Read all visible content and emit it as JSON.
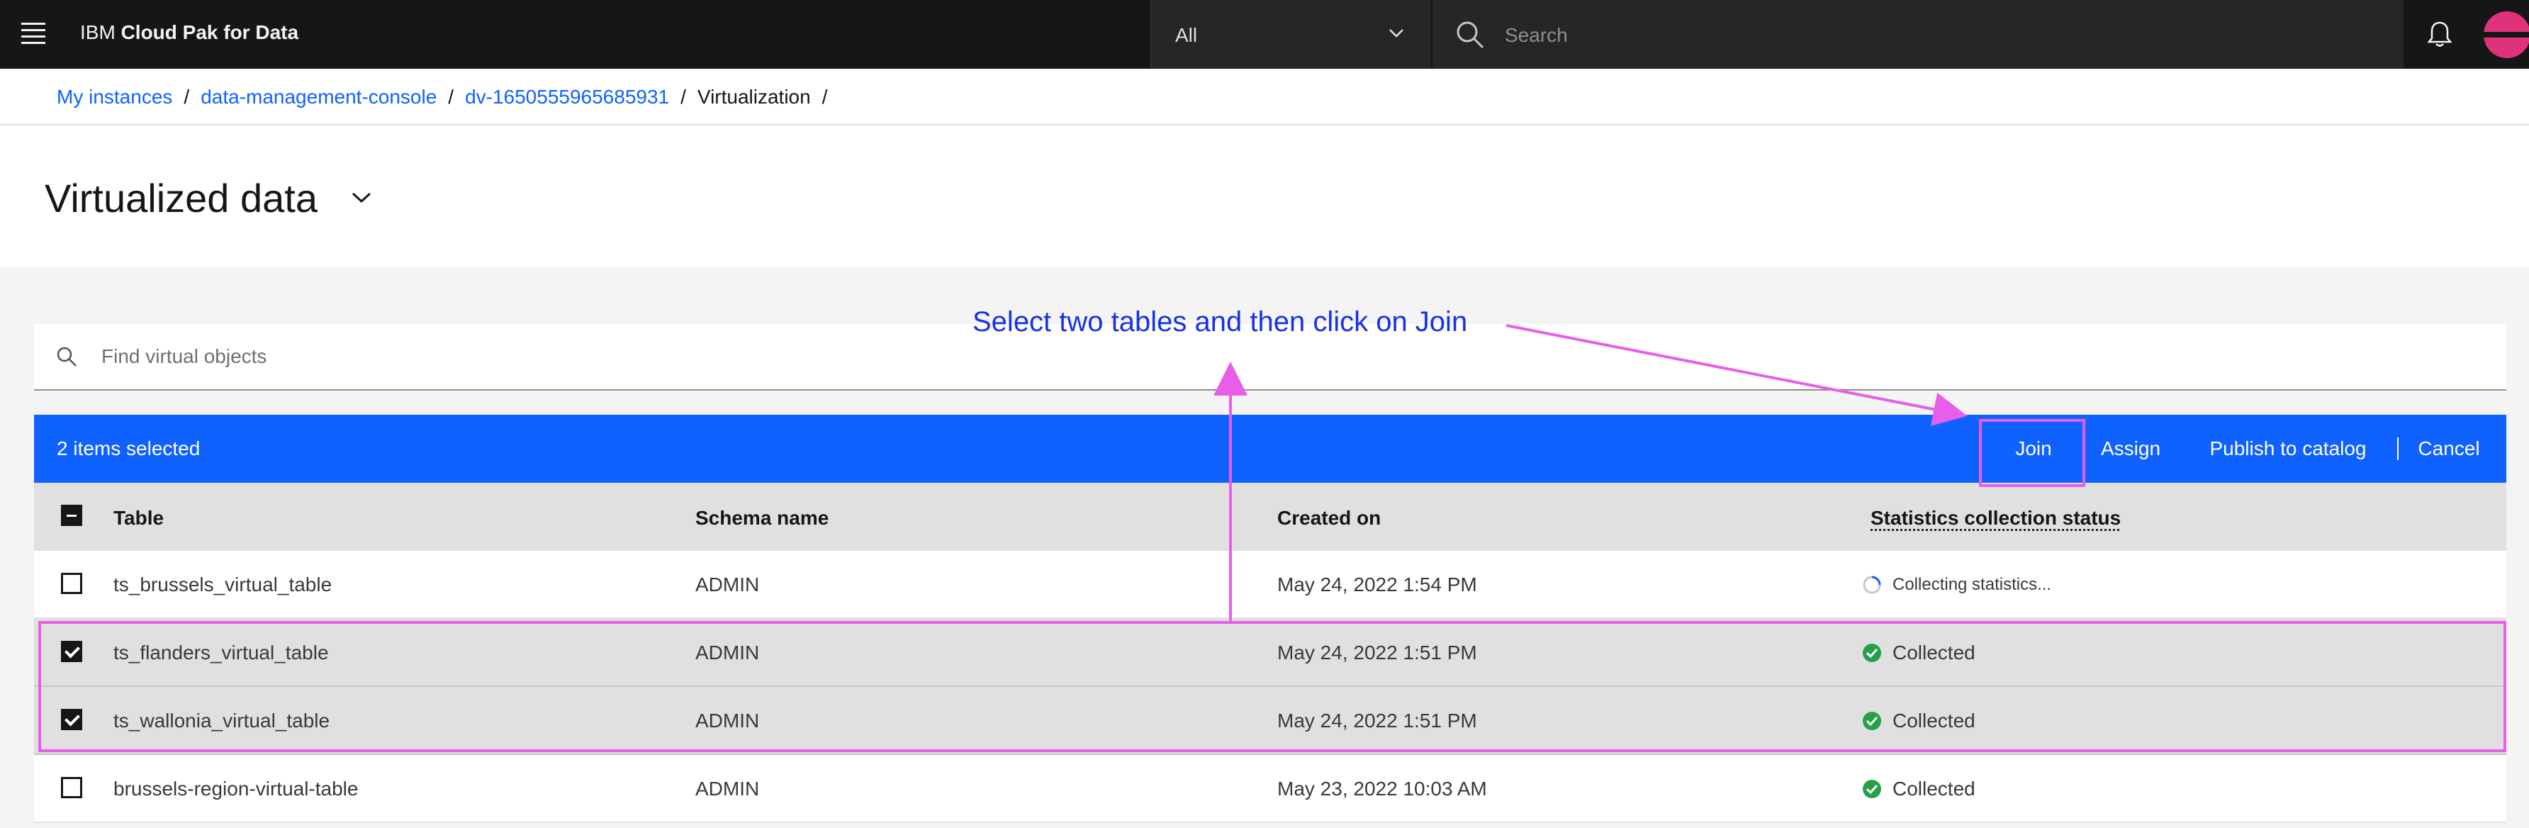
{
  "header": {
    "brand_prefix": "IBM",
    "brand_name": "Cloud Pak for Data",
    "scope_value": "All",
    "search_placeholder": "Search",
    "icons": {
      "menu": "hamburger-menu-icon",
      "search": "search-icon",
      "notifications": "bell-icon",
      "user": "avatar"
    }
  },
  "breadcrumb": {
    "items": [
      "My instances",
      "data-management-console",
      "dv-1650555965685931"
    ],
    "current": "Virtualization",
    "separator": "/"
  },
  "page": {
    "title": "Virtualized data"
  },
  "object_search": {
    "placeholder": "Find virtual objects"
  },
  "batch_actions": {
    "selected_label": "2 items selected",
    "join": "Join",
    "assign": "Assign",
    "publish": "Publish to catalog",
    "cancel": "Cancel"
  },
  "table": {
    "headers": {
      "table": "Table",
      "schema": "Schema name",
      "created": "Created on",
      "status": "Statistics collection status"
    },
    "rows": [
      {
        "table": "ts_brussels_virtual_table",
        "schema": "ADMIN",
        "created": "May 24, 2022 1:54 PM",
        "status": "Collecting statistics...",
        "checked": false
      },
      {
        "table": "ts_flanders_virtual_table",
        "schema": "ADMIN",
        "created": "May 24, 2022 1:51 PM",
        "status": "Collected",
        "checked": true
      },
      {
        "table": "ts_wallonia_virtual_table",
        "schema": "ADMIN",
        "created": "May 24, 2022 1:51 PM",
        "status": "Collected",
        "checked": true
      },
      {
        "table": "brussels-region-virtual-table",
        "schema": "ADMIN",
        "created": "May 23, 2022 10:03 AM",
        "status": "Collected",
        "checked": false
      }
    ]
  },
  "annotation": {
    "instruction": "Select two tables and then click on Join",
    "color": "#e85ee8",
    "text_color": "#1732e6"
  },
  "colors": {
    "header_bg": "#161616",
    "accent": "#0f62fe",
    "success": "#24a148"
  }
}
